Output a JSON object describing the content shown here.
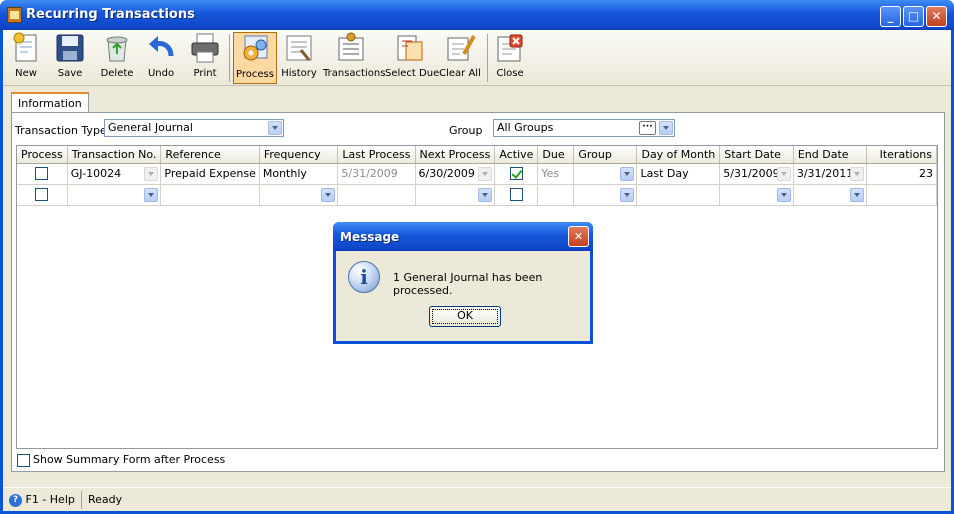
{
  "window": {
    "title": "Recurring Transactions",
    "controls": {
      "minimize": "_",
      "maximize": "□",
      "close": "✕"
    }
  },
  "toolbar": {
    "buttons": [
      {
        "label": "New",
        "icon": "new-document-icon"
      },
      {
        "label": "Save",
        "icon": "floppy-disk-icon"
      },
      {
        "label": "Delete",
        "icon": "recycle-bin-icon"
      },
      {
        "label": "Undo",
        "icon": "undo-arrow-icon"
      },
      {
        "label": "Print",
        "icon": "printer-icon"
      },
      {
        "label": "Process",
        "icon": "process-gears-icon",
        "active": true
      },
      {
        "label": "History",
        "icon": "history-icon"
      },
      {
        "label": "Transactions",
        "icon": "transactions-icon"
      },
      {
        "label": "Select Due",
        "icon": "select-due-icon"
      },
      {
        "label": "Clear All",
        "icon": "clear-all-icon"
      },
      {
        "label": "Close",
        "icon": "close-form-icon"
      }
    ]
  },
  "tabs": [
    {
      "label": "Information",
      "selected": true
    }
  ],
  "filters": {
    "transaction_type_label": "Transaction Type",
    "transaction_type_value": "General Journal",
    "group_label": "Group",
    "group_value": "All Groups",
    "group_ellipsis": "···"
  },
  "grid": {
    "columns": [
      "Process",
      "Transaction No.",
      "Reference",
      "Frequency",
      "Last Process",
      "Next Process",
      "Active",
      "Due",
      "Group",
      "Day of Month",
      "Start Date",
      "End Date",
      "Iterations"
    ],
    "rows": [
      {
        "process": false,
        "transaction_no": "GJ-10024",
        "reference": "Prepaid Expense",
        "frequency": "Monthly",
        "last_process": "5/31/2009",
        "next_process": "6/30/2009",
        "active": true,
        "due": "Yes",
        "group": "",
        "day_of_month": "Last Day",
        "start_date": "5/31/2009",
        "end_date": "3/31/2011",
        "iterations": "23"
      },
      {
        "process": false,
        "transaction_no": "",
        "reference": "",
        "frequency": "",
        "last_process": "",
        "next_process": "",
        "active": false,
        "due": "",
        "group": "",
        "day_of_month": "",
        "start_date": "",
        "end_date": "",
        "iterations": ""
      }
    ]
  },
  "options": {
    "show_summary_label": "Show Summary Form after Process",
    "show_summary_checked": false
  },
  "statusbar": {
    "help": "F1 - Help",
    "help_icon": "?",
    "status": "Ready"
  },
  "dialog": {
    "title": "Message",
    "close": "✕",
    "icon": "i",
    "message": "1 General Journal has been processed.",
    "ok_label": "OK"
  },
  "colors": {
    "titlebar": "#0a53d6",
    "active_toolbar": "#fbd9a0",
    "face": "#ece9d8"
  }
}
